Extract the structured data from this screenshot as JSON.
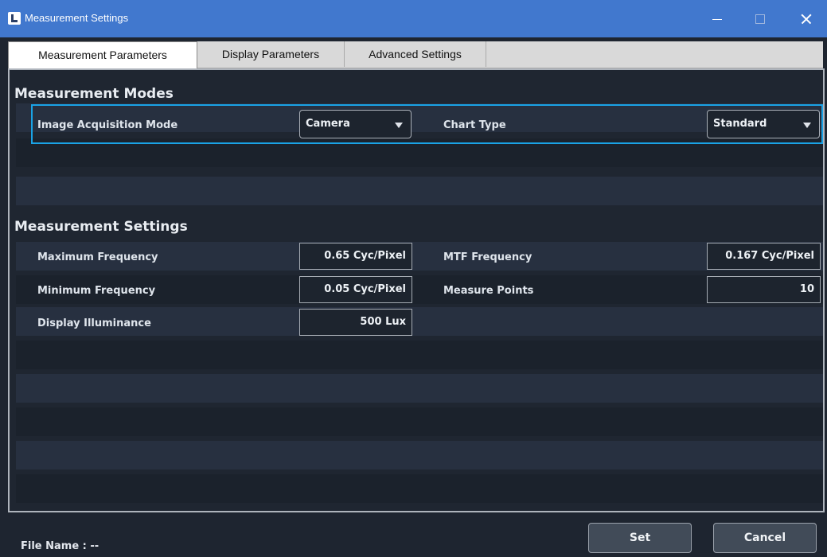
{
  "window": {
    "title": "Measurement Settings",
    "icons": [
      "app-icon",
      "minimize-icon",
      "maximize-icon",
      "close-icon"
    ]
  },
  "tabs": [
    {
      "label": "Measurement Parameters",
      "active": true
    },
    {
      "label": "Display Parameters",
      "active": false
    },
    {
      "label": "Advanced Settings",
      "active": false
    }
  ],
  "modes": {
    "title": "Measurement Modes",
    "image_acquisition_mode": {
      "label": "Image Acquisition Mode",
      "value": "Camera"
    },
    "chart_type": {
      "label": "Chart Type",
      "value": "Standard"
    }
  },
  "settings": {
    "title": "Measurement Settings",
    "max_frequency": {
      "label": "Maximum Frequency",
      "value": "0.65 Cyc/Pixel"
    },
    "mtf_frequency": {
      "label": "MTF Frequency",
      "value": "0.167 Cyc/Pixel"
    },
    "min_frequency": {
      "label": "Minimum Frequency",
      "value": "0.05 Cyc/Pixel"
    },
    "measure_points": {
      "label": "Measure Points",
      "value": "10"
    },
    "display_illuminance": {
      "label": "Display Illuminance",
      "value": "500 Lux"
    }
  },
  "footer": {
    "file_name": "File Name :  --",
    "set_label": "Set",
    "cancel_label": "Cancel"
  },
  "colors": {
    "titlebar": "#4178ce",
    "highlight": "#1aa3e6",
    "panel": "#1f2631"
  }
}
